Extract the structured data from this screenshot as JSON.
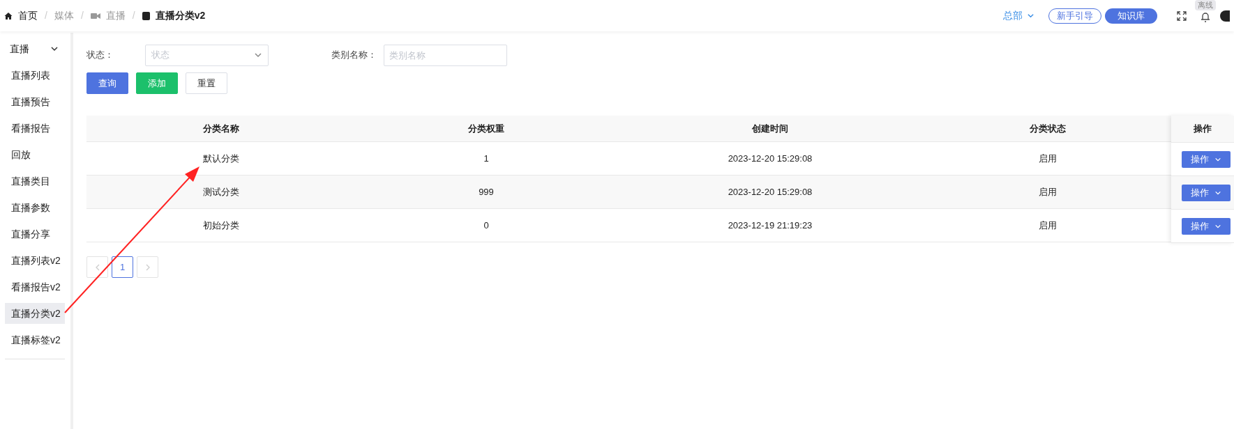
{
  "breadcrumb": [
    {
      "label": "首页",
      "kind": "home",
      "current": false
    },
    {
      "separator": "/",
      "label": "媒体",
      "kind": "plain",
      "current": false
    },
    {
      "separator": "/",
      "label": "直播",
      "kind": "video",
      "current": false
    },
    {
      "separator": "/",
      "label": "直播分类v2",
      "kind": "page",
      "current": true
    }
  ],
  "header": {
    "org": "总部",
    "guide_button": "新手引导",
    "knowledge_button": "知识库",
    "status_badge": "离线"
  },
  "sidebar": {
    "group": {
      "label": "直播",
      "expanded": true
    },
    "items": [
      {
        "label": "直播列表",
        "selected": false
      },
      {
        "label": "直播预告",
        "selected": false
      },
      {
        "label": "看播报告",
        "selected": false
      },
      {
        "label": "回放",
        "selected": false
      },
      {
        "label": "直播类目",
        "selected": false
      },
      {
        "label": "直播参数",
        "selected": false
      },
      {
        "label": "直播分享",
        "selected": false
      },
      {
        "label": "直播列表v2",
        "selected": false
      },
      {
        "label": "看播报告v2",
        "selected": false
      },
      {
        "label": "直播分类v2",
        "selected": true
      },
      {
        "label": "直播标签v2",
        "selected": false
      }
    ]
  },
  "filters": [
    {
      "label": "状态：",
      "kind": "select",
      "placeholder": "状态"
    },
    {
      "label": "类别名称：",
      "kind": "text",
      "placeholder": "类别名称"
    }
  ],
  "buttons": [
    {
      "label": "查询",
      "kind": "primary"
    },
    {
      "label": "添加",
      "kind": "success"
    },
    {
      "label": "重置",
      "kind": "default"
    }
  ],
  "table": {
    "columns": [
      "分类名称",
      "分类权重",
      "创建时间",
      "分类状态",
      "操作"
    ],
    "rows": [
      {
        "cells": [
          "默认分类",
          "1",
          "2023-12-20 15:29:08",
          "启用"
        ],
        "action": "操作"
      },
      {
        "cells": [
          "测试分类",
          "999",
          "2023-12-20 15:29:08",
          "启用"
        ],
        "action": "操作"
      },
      {
        "cells": [
          "初始分类",
          "0",
          "2023-12-19 21:19:23",
          "启用"
        ],
        "action": "操作"
      }
    ]
  },
  "pagination": {
    "pages": [
      {
        "label": "1",
        "selected": true
      }
    ]
  }
}
